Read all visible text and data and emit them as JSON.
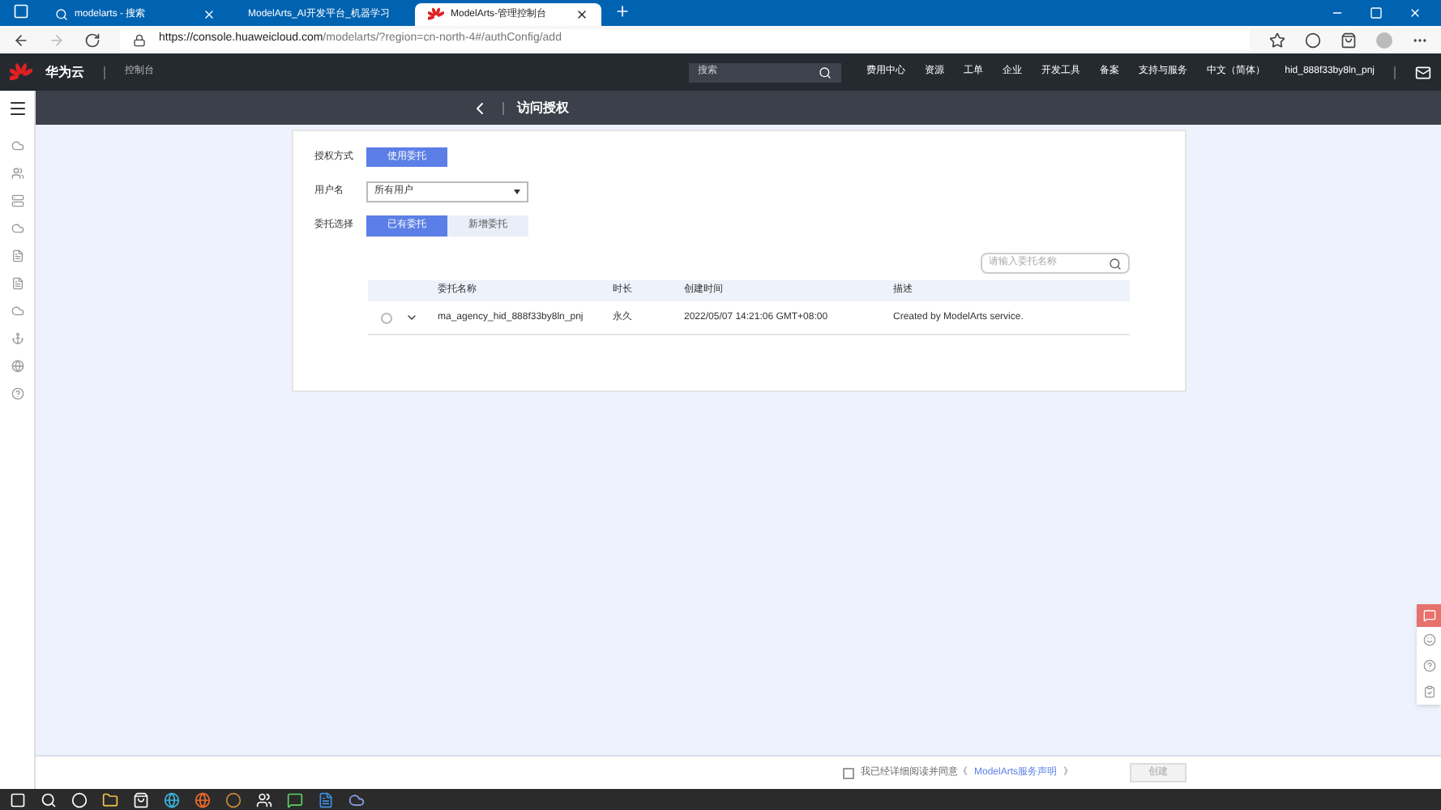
{
  "browser": {
    "tabs": [
      {
        "title": "modelarts - 搜索",
        "selected": false,
        "kind": "search"
      },
      {
        "title": "ModelArts_AI开发平台_机器学习",
        "selected": false,
        "kind": "huawei"
      },
      {
        "title": "ModelArts-管理控制台",
        "selected": true,
        "kind": "huawei"
      }
    ],
    "url": {
      "host": "https://console.huaweicloud.com",
      "path": "/modelarts/?region=cn-north-4#/authConfig/add"
    }
  },
  "header": {
    "brand": "华为云",
    "console": "控制台",
    "search_placeholder": "搜索",
    "menu": [
      "费用中心",
      "资源",
      "工单",
      "企业",
      "开发工具",
      "备案",
      "支持与服务",
      "中文（简体）",
      "hid_888f33by8ln_pnj"
    ]
  },
  "page_title": "访问授权",
  "form": {
    "auth_label": "授权方式",
    "auth_button": "使用委托",
    "user_label": "用户名",
    "user_value": "所有用户",
    "agency_label": "委托选择",
    "agency_options": [
      {
        "label": "已有委托",
        "selected": true
      },
      {
        "label": "新增委托",
        "selected": false
      }
    ],
    "search_placeholder": "请输入委托名称"
  },
  "table": {
    "columns": [
      "委托名称",
      "时长",
      "创建时间",
      "描述"
    ],
    "rows": [
      {
        "selected": false,
        "name": "ma_agency_hid_888f33by8ln_pnj",
        "duration": "永久",
        "created": "2022/05/07 14:21:06 GMT+08:00",
        "description": "Created by ModelArts service."
      }
    ]
  },
  "footer": {
    "agree_checked": false,
    "agree_text": "我已经详细阅读并同意《",
    "agree_link": "ModelArts服务声明",
    "agree_end": "》",
    "create_button": "创建"
  }
}
